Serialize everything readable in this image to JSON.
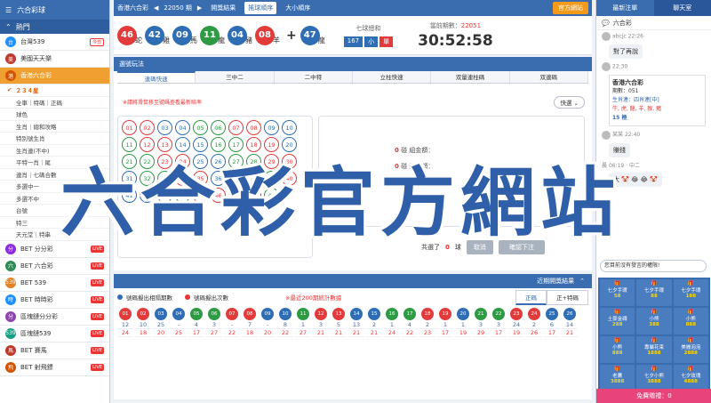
{
  "sidebar": {
    "title": "六合彩球",
    "hot_label": "熱門",
    "items_top": [
      {
        "label": "台灣539",
        "badge": "今日"
      },
      {
        "label": "美國天天樂"
      }
    ],
    "active_item": "香港六合彩",
    "sub_current": "２３４星",
    "sub_items": [
      "全車｜特碼｜正碼",
      "球色",
      "生肖｜總和攻略",
      "特別號生肖",
      "生肖連(不中)",
      "平特一肖｜尾",
      "連肖｜七碼合數",
      "多選中一",
      "多選不中",
      "台號",
      "特三",
      "天元堂｜特串"
    ],
    "live_items": [
      {
        "icon": "分",
        "label": "BET 分分彩",
        "color": "#8a2be2"
      },
      {
        "icon": "六",
        "label": "BET 六合彩",
        "color": "#2e8b57"
      },
      {
        "icon": "539",
        "label": "BET 539",
        "color": "#e67e22"
      },
      {
        "icon": "時",
        "label": "BET 時時彩",
        "color": "#1e90ff"
      },
      {
        "icon": "分",
        "label": "區塊鏈分分彩",
        "color": "#8e44ad"
      },
      {
        "icon": "539",
        "label": "區塊鏈539",
        "color": "#16a085"
      },
      {
        "icon": "馬",
        "label": "BET 賽馬",
        "color": "#c0392b"
      },
      {
        "icon": "飛",
        "label": "BET 射飛鏢",
        "color": "#d35400"
      }
    ],
    "live_badge": "LIVE"
  },
  "topbar": {
    "game": "香港六合彩",
    "period": "22050 期",
    "tabs": [
      "開獎結果",
      "搖球順序",
      "大小順序"
    ],
    "active_tab": 1,
    "official": "官方網站"
  },
  "result": {
    "balls": [
      {
        "n": "46",
        "z": "蛇",
        "c": "#e23b3b"
      },
      {
        "n": "42",
        "z": "雞",
        "c": "#2f6db5"
      },
      {
        "n": "09",
        "z": "馬",
        "c": "#2f6db5"
      },
      {
        "n": "11",
        "z": "龍",
        "c": "#2e9a44"
      },
      {
        "n": "04",
        "z": "豬",
        "c": "#2f6db5"
      },
      {
        "n": "08",
        "z": "羊",
        "c": "#e23b3b"
      }
    ],
    "special": {
      "n": "47",
      "z": "龍",
      "c": "#2f6db5"
    },
    "total_label": "七球總和",
    "total": "167",
    "size": "小",
    "odd": "單",
    "current_label": "當前期數：",
    "current_period": "22051",
    "countdown": "30:52:58"
  },
  "play": {
    "section_title": "選號玩法",
    "tabs": [
      "連碼快速",
      "三中二",
      "二中特",
      "立柱快速",
      "双量連柱碼",
      "双連碼"
    ],
    "hint": "※請將滑鼠移至號碼查看最新賠率",
    "mode": "快選",
    "numbers": [
      [
        "01",
        "02",
        "03",
        "04",
        "05",
        "06",
        "07",
        "08",
        "09",
        "10"
      ],
      [
        "11",
        "12",
        "13",
        "14",
        "15",
        "16",
        "17",
        "18",
        "19",
        "20"
      ],
      [
        "21",
        "22",
        "23",
        "24",
        "25",
        "26",
        "27",
        "28",
        "29",
        "30"
      ],
      [
        "31",
        "32",
        "33",
        "34",
        "35",
        "36",
        "37",
        "38",
        "39",
        "40"
      ],
      [
        "41",
        "42",
        "43",
        "44",
        "45",
        "46",
        "47",
        "48",
        "49"
      ]
    ],
    "bet_rows": [
      {
        "v": "0",
        "t": "碰",
        "l": "組金額："
      },
      {
        "v": "0",
        "t": "碰",
        "l": "總金額："
      },
      {
        "v": "0",
        "t": "碰",
        "l": ""
      }
    ],
    "selected_label": "共選了",
    "selected_count": "0",
    "selected_unit": "球",
    "cancel": "取消",
    "confirm": "確認下注"
  },
  "recent": {
    "title": "近期開獎結果",
    "legend_blue": "號碼擬出相隔期數",
    "legend_red": "號碼擬出次數",
    "note": "※最近200期統計數據",
    "tabs": [
      "正碼",
      "正+特碼"
    ],
    "cols": [
      {
        "n": "01",
        "c": "#e23b3b",
        "a": "12",
        "b": "24"
      },
      {
        "n": "02",
        "c": "#e23b3b",
        "a": "10",
        "b": "18"
      },
      {
        "n": "03",
        "c": "#2f6db5",
        "a": "25",
        "b": "20"
      },
      {
        "n": "04",
        "c": "#2f6db5",
        "a": "-",
        "b": "25"
      },
      {
        "n": "05",
        "c": "#2e9a44",
        "a": "4",
        "b": "17"
      },
      {
        "n": "06",
        "c": "#2e9a44",
        "a": "3",
        "b": "27"
      },
      {
        "n": "07",
        "c": "#e23b3b",
        "a": "-",
        "b": "22"
      },
      {
        "n": "08",
        "c": "#e23b3b",
        "a": "7",
        "b": "18"
      },
      {
        "n": "09",
        "c": "#2f6db5",
        "a": "-",
        "b": "20"
      },
      {
        "n": "10",
        "c": "#2f6db5",
        "a": "8",
        "b": "22"
      },
      {
        "n": "11",
        "c": "#2e9a44",
        "a": "1",
        "b": "27"
      },
      {
        "n": "12",
        "c": "#e23b3b",
        "a": "3",
        "b": "21"
      },
      {
        "n": "13",
        "c": "#e23b3b",
        "a": "5",
        "b": "21"
      },
      {
        "n": "14",
        "c": "#2f6db5",
        "a": "13",
        "b": "21"
      },
      {
        "n": "15",
        "c": "#2f6db5",
        "a": "2",
        "b": "21"
      },
      {
        "n": "16",
        "c": "#2e9a44",
        "a": "1",
        "b": "24"
      },
      {
        "n": "17",
        "c": "#2e9a44",
        "a": "4",
        "b": "22"
      },
      {
        "n": "18",
        "c": "#e23b3b",
        "a": "2",
        "b": "23"
      },
      {
        "n": "19",
        "c": "#e23b3b",
        "a": "1",
        "b": "17"
      },
      {
        "n": "20",
        "c": "#2f6db5",
        "a": "1",
        "b": "19"
      },
      {
        "n": "21",
        "c": "#2e9a44",
        "a": "3",
        "b": "29"
      },
      {
        "n": "22",
        "c": "#2e9a44",
        "a": "3",
        "b": "17"
      },
      {
        "n": "23",
        "c": "#e23b3b",
        "a": "24",
        "b": "19"
      },
      {
        "n": "24",
        "c": "#e23b3b",
        "a": "2",
        "b": "26"
      },
      {
        "n": "25",
        "c": "#2f6db5",
        "a": "6",
        "b": "17"
      },
      {
        "n": "26",
        "c": "#2f6db5",
        "a": "14",
        "b": "21"
      }
    ]
  },
  "chat": {
    "tabs": [
      "最新注單",
      "聊天室"
    ],
    "active_tab": 1,
    "room": "六合彩",
    "messages": [
      {
        "user": "abcjc",
        "time": "22:26",
        "text": "對了再說"
      },
      {
        "user": "",
        "time": "22:30",
        "text": ""
      }
    ],
    "card": {
      "title": "香港六合彩",
      "period": "期數：051",
      "tag": "生肖連：四肖連[中]",
      "zodiac": "牛, 虎, 龍, 羊, 猴, 豬",
      "rate": "15 極"
    },
    "msg3_user": "某某",
    "msg3_time": "22:40",
    "msg3_text": "賺錢",
    "msg4_user": "晨",
    "msg4_time": "06:19",
    "msg4_text": "大 🤡 😂 😂 🤡 ",
    "msg5_text": "中二",
    "input_placeholder": "您目前沒有發言的權限!",
    "gifts": [
      {
        "n": "七夕手環",
        "v": "58"
      },
      {
        "n": "七夕手環",
        "v": "88"
      },
      {
        "n": "七夕手環",
        "v": "188"
      },
      {
        "n": "土豪金磚",
        "v": "288"
      },
      {
        "n": "小熊",
        "v": "388"
      },
      {
        "n": "小熊",
        "v": "888"
      },
      {
        "n": "小熊",
        "v": "888"
      },
      {
        "n": "專屬花束",
        "v": "1888"
      },
      {
        "n": "美麗泡泡",
        "v": "2888"
      },
      {
        "n": "老鷹",
        "v": "3888"
      },
      {
        "n": "七夕小熊",
        "v": "3888"
      },
      {
        "n": "七夕玫瑰",
        "v": "4888"
      }
    ],
    "free_label": "免費贈禮：0"
  },
  "overlay_text": "六合彩官方網站"
}
